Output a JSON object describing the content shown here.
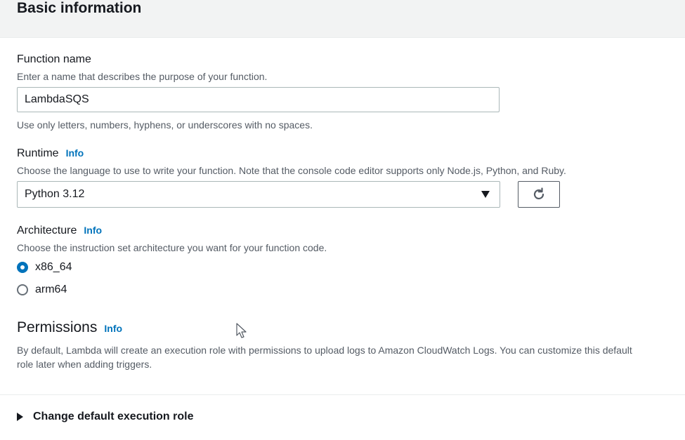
{
  "section": {
    "title": "Basic information"
  },
  "function_name": {
    "label": "Function name",
    "description": "Enter a name that describes the purpose of your function.",
    "value": "LambdaSQS",
    "hint": "Use only letters, numbers, hyphens, or underscores with no spaces."
  },
  "runtime": {
    "label": "Runtime",
    "info": "Info",
    "description": "Choose the language to use to write your function. Note that the console code editor supports only Node.js, Python, and Ruby.",
    "selected": "Python 3.12",
    "refresh_icon": "refresh-icon"
  },
  "architecture": {
    "label": "Architecture",
    "info": "Info",
    "description": "Choose the instruction set architecture you want for your function code.",
    "options": [
      {
        "label": "x86_64",
        "checked": true
      },
      {
        "label": "arm64",
        "checked": false
      }
    ]
  },
  "permissions": {
    "title": "Permissions",
    "info": "Info",
    "description": "By default, Lambda will create an execution role with permissions to upload logs to Amazon CloudWatch Logs. You can customize this default role later when adding triggers."
  },
  "expander": {
    "label": "Change default execution role"
  },
  "colors": {
    "accent": "#0073bb",
    "header_bg": "#f2f3f3",
    "text": "#16191f",
    "muted": "#545b64"
  }
}
